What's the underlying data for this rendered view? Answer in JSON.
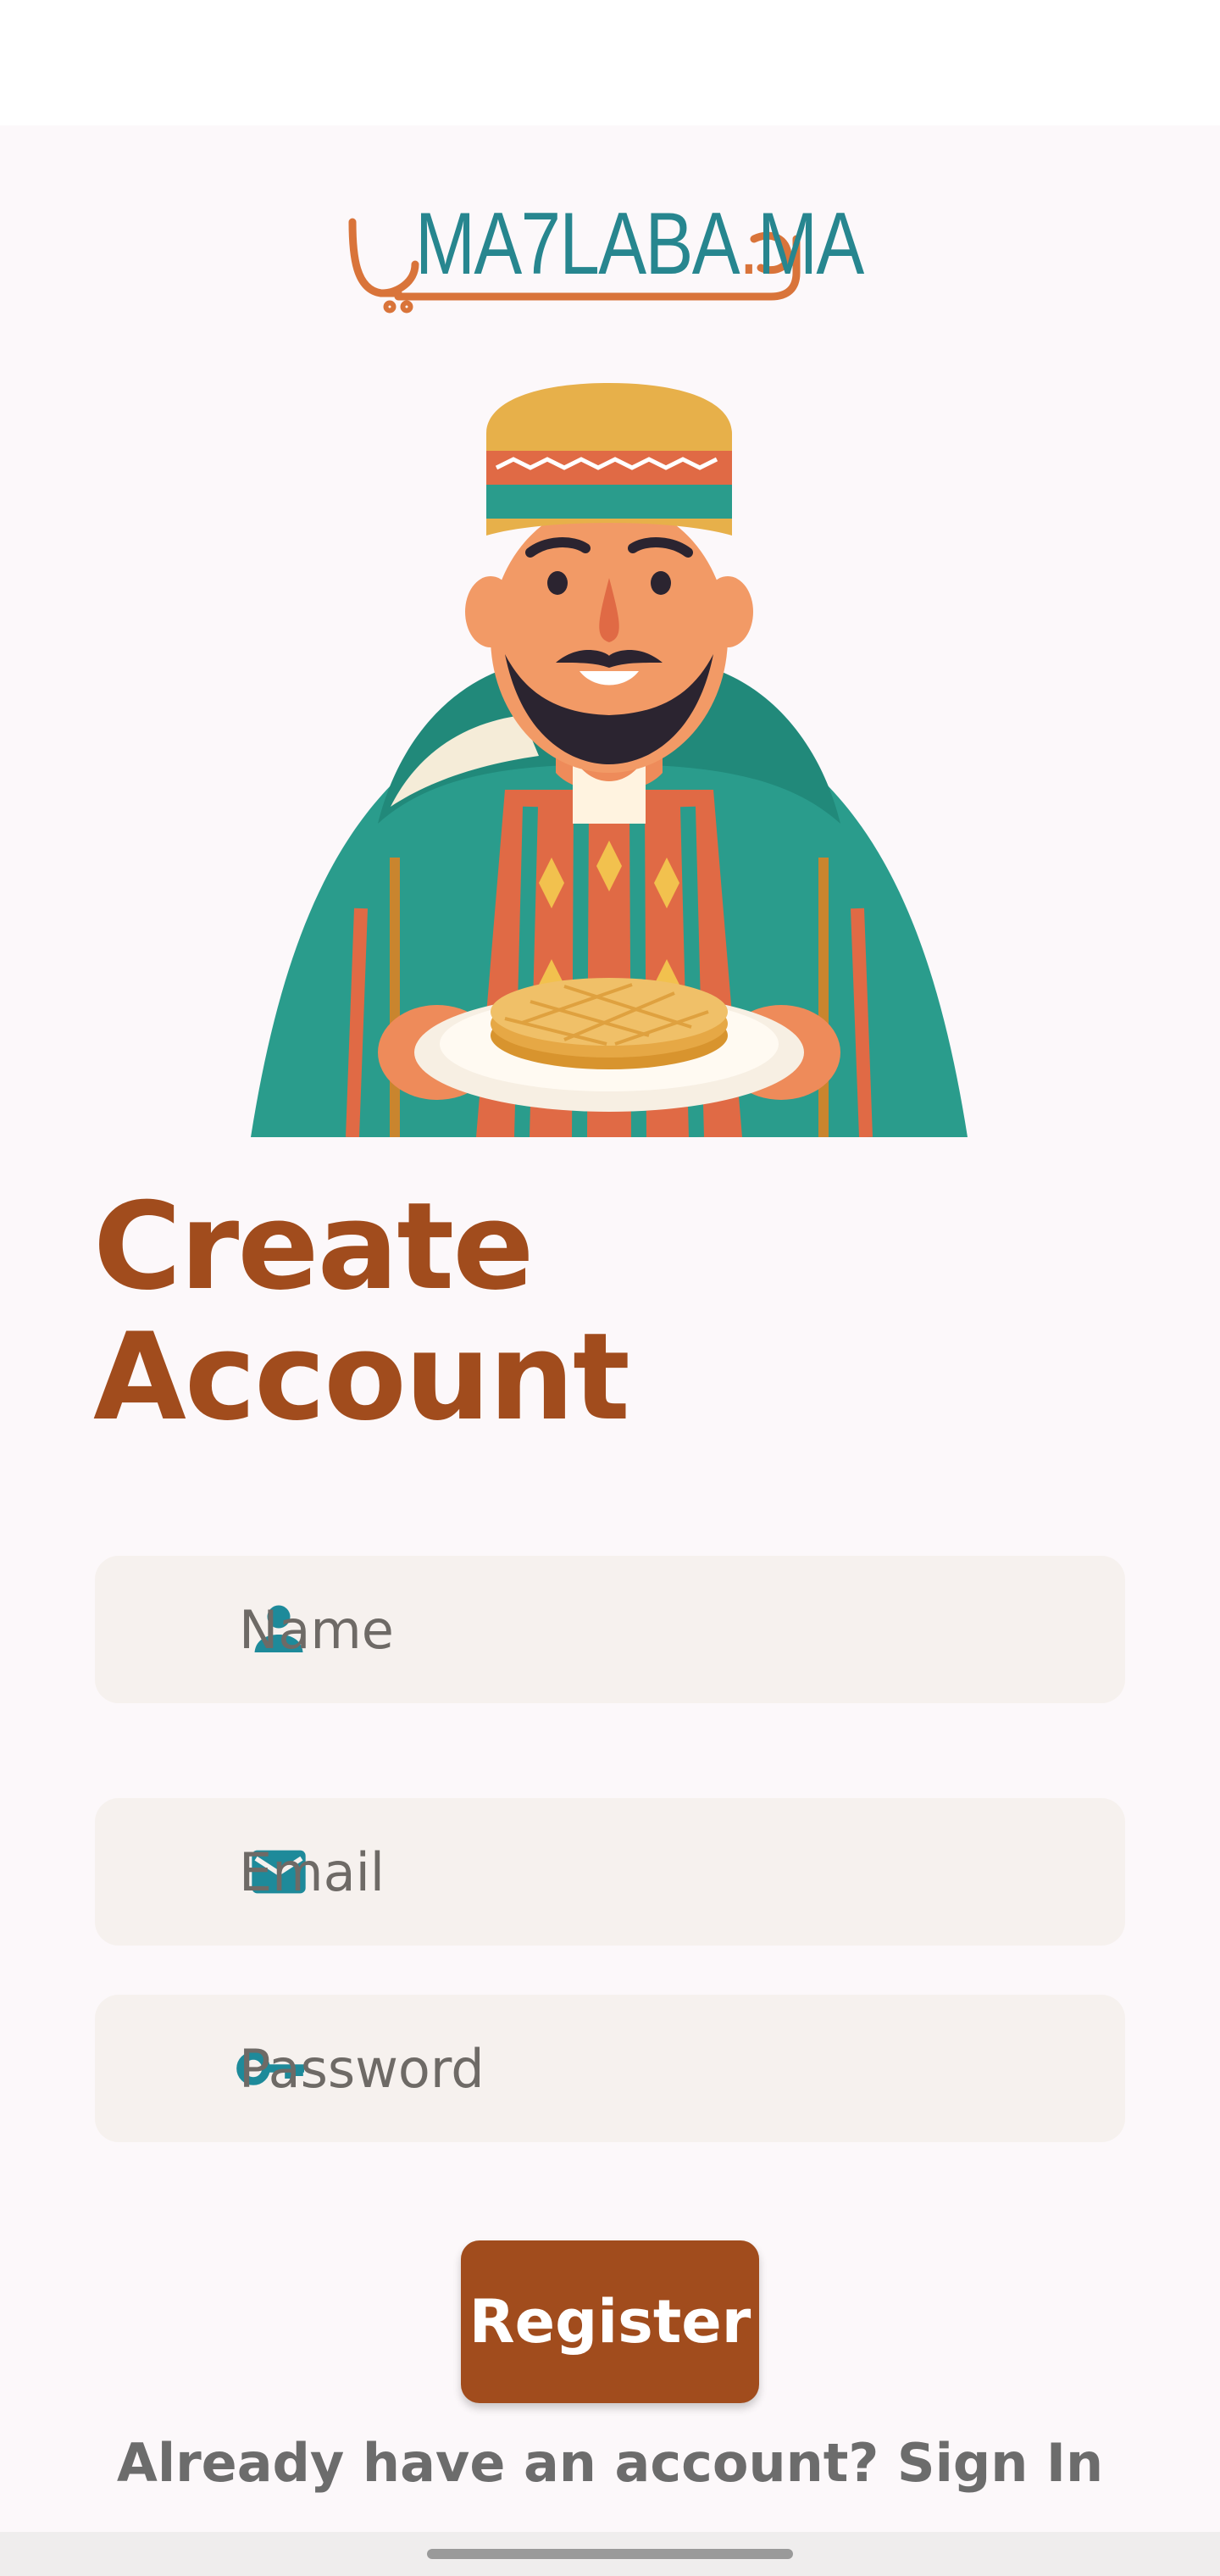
{
  "logo": {
    "text_latin": "MA7LABA",
    "text_dot": ".",
    "text_tld": "MA",
    "arabic_wordmark": "محلبة"
  },
  "illustration": {
    "description_icon": "moroccan-man-with-pancakes-illustration"
  },
  "title": {
    "line1": "Create",
    "line2": "Account"
  },
  "fields": {
    "name": {
      "placeholder": "Name",
      "icon": "person-icon"
    },
    "email": {
      "placeholder": "Email",
      "icon": "mail-icon"
    },
    "password": {
      "placeholder": "Password",
      "icon": "key-icon"
    }
  },
  "register_label": "Register",
  "signin": {
    "prompt": "Already have an account? ",
    "link": "Sign In"
  },
  "colors": {
    "primary": "#a14c1d",
    "accent_teal": "#1e8a9a",
    "field_bg": "#f6f1ee",
    "background": "#fcf8fa"
  }
}
